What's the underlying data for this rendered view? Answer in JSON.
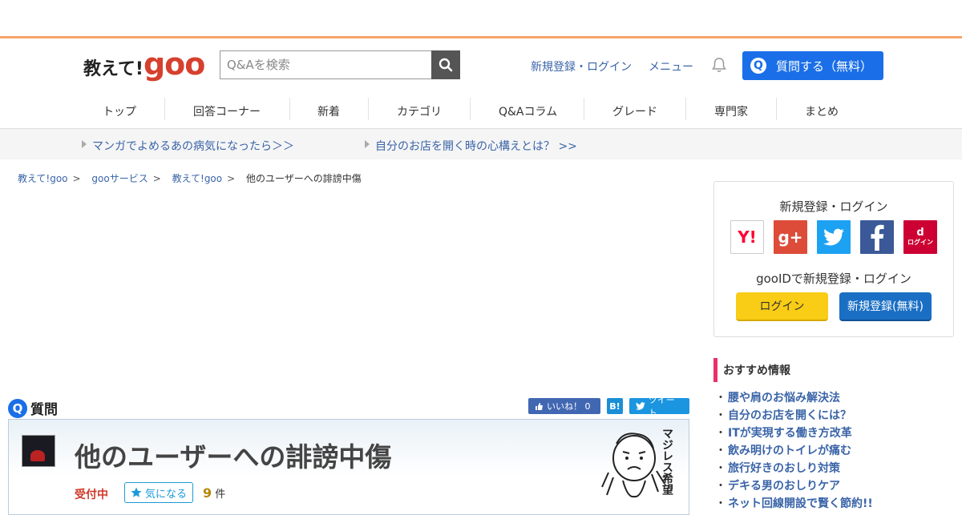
{
  "header": {
    "logo_text": "教えて!",
    "logo_goo": "goo",
    "search_placeholder": "Q&Aを検索",
    "register_login": "新規登録・ログイン",
    "menu": "メニュー",
    "ask_button": "質問する（無料）",
    "ask_badge": "Q"
  },
  "nav": [
    "トップ",
    "回答コーナー",
    "新着",
    "カテゴリ",
    "Q&Aコラム",
    "グレード",
    "専門家",
    "まとめ"
  ],
  "promos": [
    "マンガでよめるあの病気になったら＞＞",
    "自分のお店を開く時の心構えとは？ >>"
  ],
  "breadcrumb": [
    "教えて!goo",
    "gooサービス",
    "教えて!goo",
    "他のユーザーへの誹謗中傷"
  ],
  "question": {
    "badge": "Q",
    "label": "質問",
    "title": "他のユーザーへの誹謗中傷",
    "status": "受付中",
    "favorite": "気になる",
    "count": "9",
    "count_unit": "件",
    "stamp_text": "マジレス希望"
  },
  "share": {
    "like": "いいね！ 0",
    "hatena": "B!",
    "tweet": "ツイート"
  },
  "sidebar": {
    "login_title": "新規登録・ログイン",
    "sns": [
      "Y!",
      "g+",
      "twitter",
      "facebook",
      "dログイン"
    ],
    "docomo_small": "ログイン",
    "gooid_title": "gooIDで新規登録・ログイン",
    "login_button": "ログイン",
    "register_button": "新規登録(無料)",
    "reco_title": "おすすめ情報",
    "reco_items": [
      "腰や肩のお悩み解決法",
      "自分のお店を開くには？",
      "ITが実現する働き方改革",
      "飲み明けのトイレが痛む",
      "旅行好きのおしり対策",
      "デキる男のおしりケア",
      "ネット回線開設で賢く節約!!"
    ]
  },
  "colors": {
    "accent_orange": "#f5a46b",
    "brand_red": "#d6402e",
    "ask_blue": "#1a6fe8",
    "link_blue": "#3a64a8",
    "status_red": "#d03a2a",
    "reco_pink": "#e8306a"
  }
}
